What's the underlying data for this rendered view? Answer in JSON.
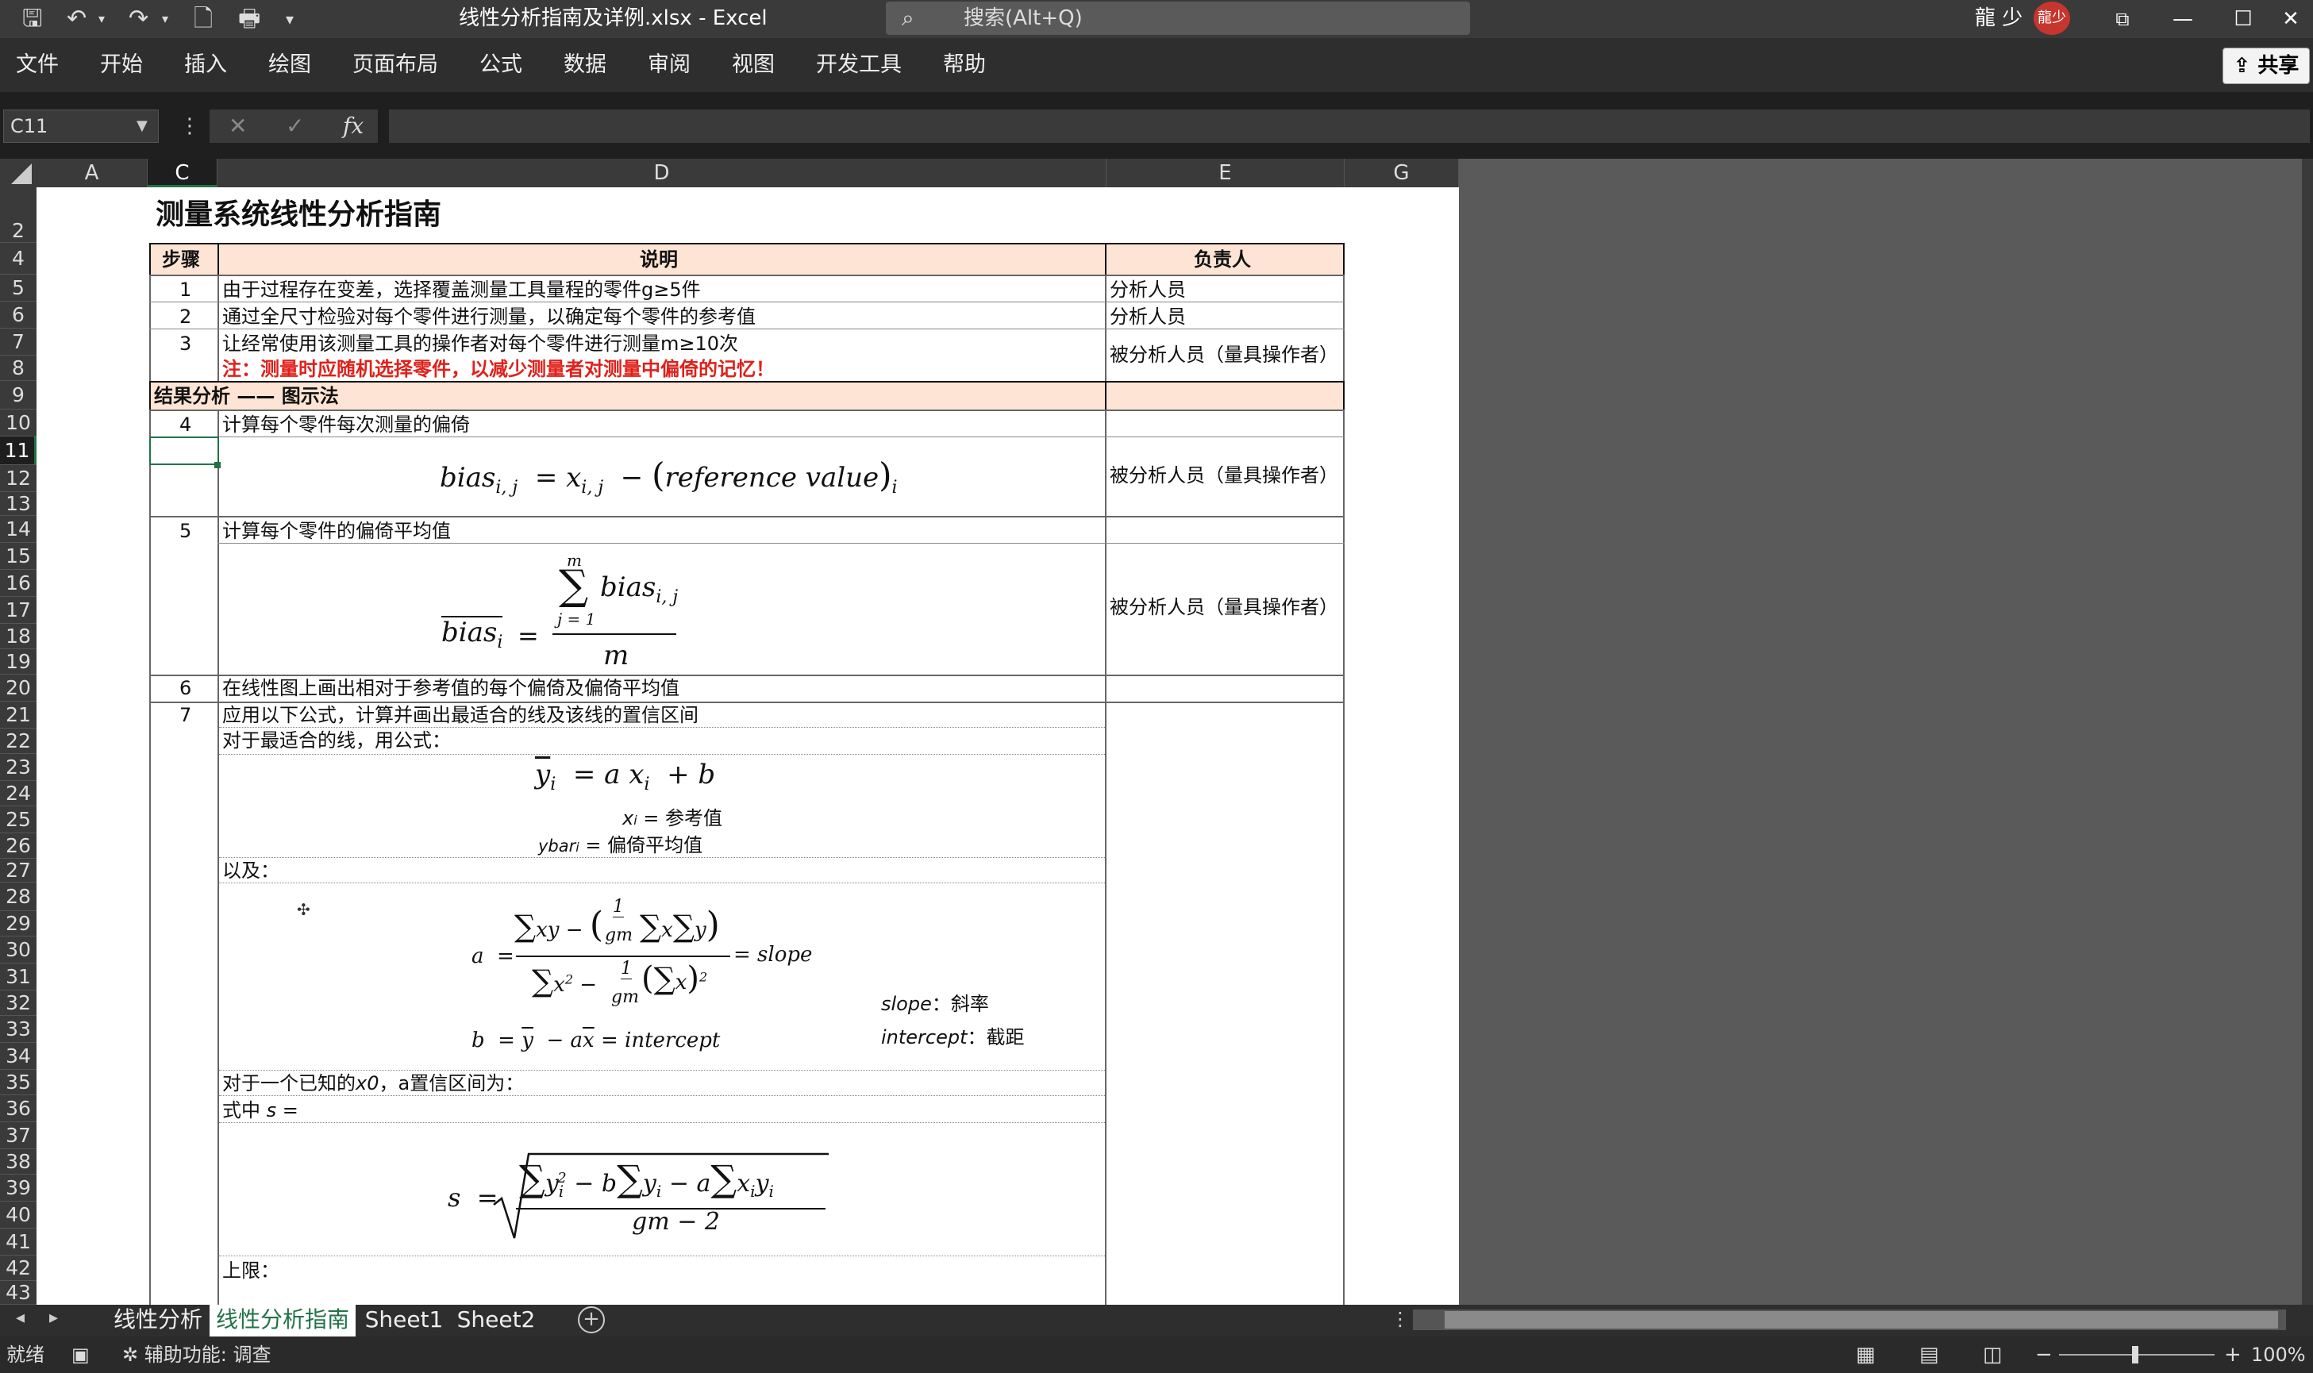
{
  "titlebar": {
    "file_title": "线性分析指南及详例.xlsx  -  Excel",
    "search_placeholder": "搜索(Alt+Q)",
    "user_name": "龍 少",
    "avatar_text": "龍少",
    "icons": [
      "save-icon",
      "undo-icon",
      "redo-icon",
      "new-file-icon",
      "print-preview-icon",
      "customize-icon",
      "search-icon",
      "ribbon-display-icon",
      "minimize-icon",
      "maximize-icon",
      "close-icon"
    ]
  },
  "ribbon": {
    "tabs": [
      "文件",
      "开始",
      "插入",
      "绘图",
      "页面布局",
      "公式",
      "数据",
      "审阅",
      "视图",
      "开发工具",
      "帮助"
    ],
    "share_label": "共享"
  },
  "formula_bar": {
    "name_box": "C11",
    "fx": "fx",
    "cancel": "✕",
    "enter": "✓",
    "value": ""
  },
  "columns": [
    "A",
    "C",
    "D",
    "E",
    "G"
  ],
  "rows": [
    "2",
    "4",
    "5",
    "6",
    "7",
    "8",
    "9",
    "10",
    "11",
    "12",
    "13",
    "14",
    "15",
    "16",
    "17",
    "18",
    "19",
    "20",
    "21",
    "22",
    "23",
    "24",
    "25",
    "26",
    "27",
    "28",
    "29",
    "30",
    "31",
    "32",
    "33",
    "34",
    "35",
    "36",
    "37",
    "38",
    "39",
    "40",
    "41",
    "42",
    "43"
  ],
  "sheet": {
    "title": "测量系统线性分析指南",
    "header": {
      "step": "步骤",
      "desc": "说明",
      "owner": "负责人"
    },
    "r5": {
      "step": "1",
      "desc": "由于过程存在变差，选择覆盖测量工具量程的零件g≥5件",
      "owner": "分析人员"
    },
    "r6": {
      "step": "2",
      "desc": "通过全尺寸检验对每个零件进行测量，以确定每个零件的参考值",
      "owner": "分析人员"
    },
    "r7": {
      "step": "3",
      "desc": "让经常使用该测量工具的操作者对每个零件进行测量m≥10次",
      "note": "注：测量时应随机选择零件，以减少测量者对测量中偏倚的记忆！",
      "owner": "被分析人员（量具操作者）"
    },
    "section": "结果分析 —— 图示法",
    "r10": {
      "step": "4",
      "desc": "计算每个零件每次测量的偏倚"
    },
    "r12_owner": "被分析人员（量具操作者）",
    "r14": {
      "step": "5",
      "desc": "计算每个零件的偏倚平均值"
    },
    "r17_owner": "被分析人员（量具操作者）",
    "r20": {
      "step": "6",
      "desc": "在线性图上画出相对于参考值的每个偏倚及偏倚平均值"
    },
    "r21": {
      "step": "7",
      "desc": "应用以下公式，计算并画出最适合的线及该线的置信区间"
    },
    "r22": "对于最适合的线，用公式：",
    "xi_label": "x",
    "xi_sub": "i",
    "xi_def": " = 参考值",
    "ybar_label": "ybar",
    "ybar_sub": "i",
    "ybar_def": " = 偏倚平均值",
    "r27": "以及：",
    "slope_label": "slope",
    "slope_def": "：斜率",
    "intercept_label": "intercept",
    "intercept_def": "：截距",
    "r35_a": "对于一个已知的",
    "r35_x0": "x0",
    "r35_b": "，a置信区间为：",
    "r36_a": "式中",
    "r36_s": "s",
    "r36_b": " =",
    "r42": "上限："
  },
  "sheet_tabs": [
    "线性分析",
    "线性分析指南",
    "Sheet1",
    "Sheet2"
  ],
  "status": {
    "ready": "就绪",
    "accessibility": "辅助功能: 调查",
    "zoom": "100%"
  }
}
